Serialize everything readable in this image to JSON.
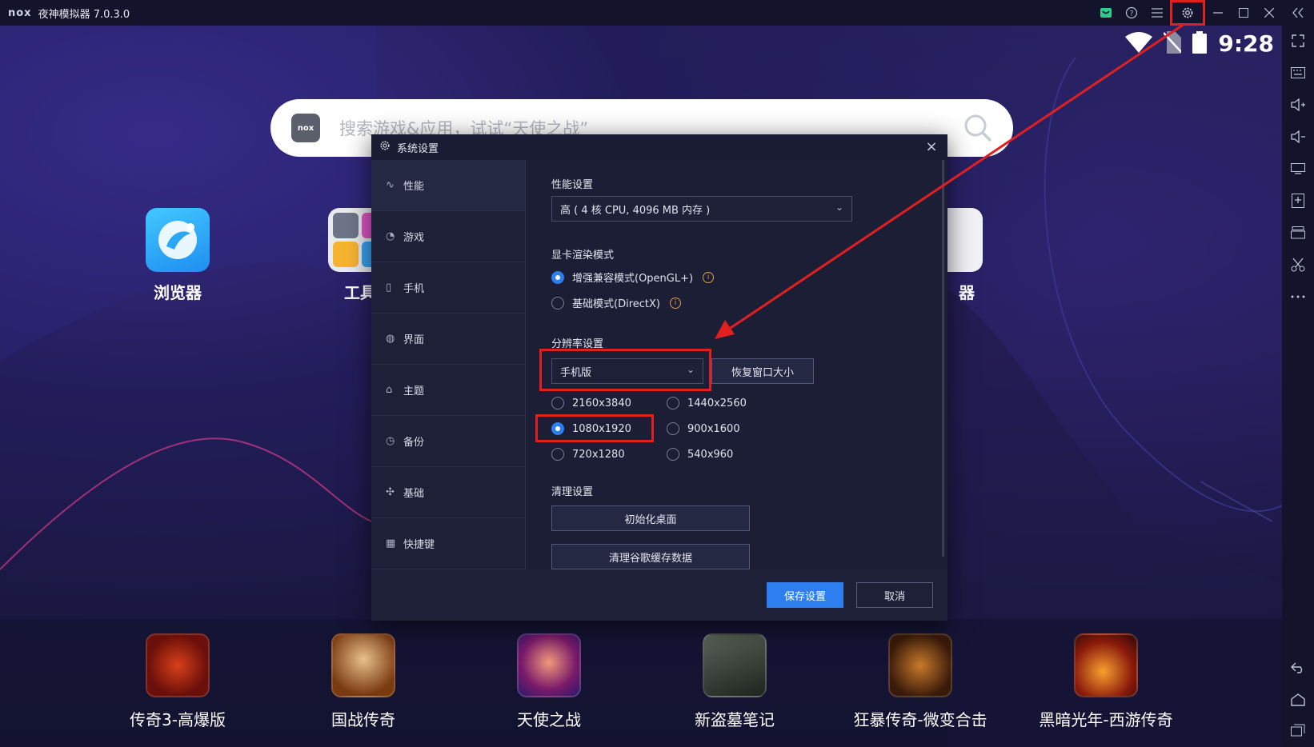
{
  "titlebar": {
    "logo": "nox",
    "title": "夜神模拟器 7.0.3.0",
    "icons": [
      "gift-icon",
      "help-icon",
      "menu-icon",
      "gear-icon",
      "minimize-icon",
      "maximize-icon",
      "close-icon",
      "collapse-icon"
    ]
  },
  "statusbar": {
    "time": "9:28"
  },
  "search": {
    "logo": "nox",
    "placeholder": "搜索游戏&应用，试试“天使之战”"
  },
  "desktop_apps": [
    {
      "label": "浏览器"
    },
    {
      "label": "工具"
    },
    {
      "label": "器"
    }
  ],
  "dock_apps": [
    {
      "label": "传奇3-高爆版"
    },
    {
      "label": "国战传奇"
    },
    {
      "label": "天使之战"
    },
    {
      "label": "新盗墓笔记"
    },
    {
      "label": "狂暴传奇-微变合击"
    },
    {
      "label": "黑暗光年-西游传奇"
    }
  ],
  "dialog": {
    "title": "系统设置",
    "nav": [
      {
        "label": "性能",
        "icon": "pulse-icon"
      },
      {
        "label": "游戏",
        "icon": "gamepad-icon"
      },
      {
        "label": "手机",
        "icon": "phone-icon"
      },
      {
        "label": "界面",
        "icon": "palette-icon"
      },
      {
        "label": "主题",
        "icon": "shirt-icon"
      },
      {
        "label": "备份",
        "icon": "history-icon"
      },
      {
        "label": "基础",
        "icon": "puzzle-icon"
      },
      {
        "label": "快捷键",
        "icon": "keyboard-icon"
      }
    ],
    "performance": {
      "title": "性能设置",
      "value": "高 ( 4 核 CPU, 4096 MB 内存 )"
    },
    "render": {
      "title": "显卡渲染模式",
      "options": [
        {
          "label": "增强兼容模式(OpenGL+)",
          "selected": true
        },
        {
          "label": "基础模式(DirectX)",
          "selected": false
        }
      ]
    },
    "resolution": {
      "title": "分辨率设置",
      "mode": "手机版",
      "restore_button": "恢复窗口大小",
      "options": [
        {
          "label": "2160x3840",
          "selected": false
        },
        {
          "label": "1440x2560",
          "selected": false
        },
        {
          "label": "1080x1920",
          "selected": true
        },
        {
          "label": "900x1600",
          "selected": false
        },
        {
          "label": "720x1280",
          "selected": false
        },
        {
          "label": "540x960",
          "selected": false
        }
      ]
    },
    "cleanup": {
      "title": "清理设置",
      "reset_desktop": "初始化桌面",
      "clear_cache": "清理谷歌缓存数据"
    },
    "footer": {
      "save": "保存设置",
      "cancel": "取消"
    }
  },
  "colors": {
    "accent": "#2d7ff0",
    "highlight": "#e02020"
  }
}
